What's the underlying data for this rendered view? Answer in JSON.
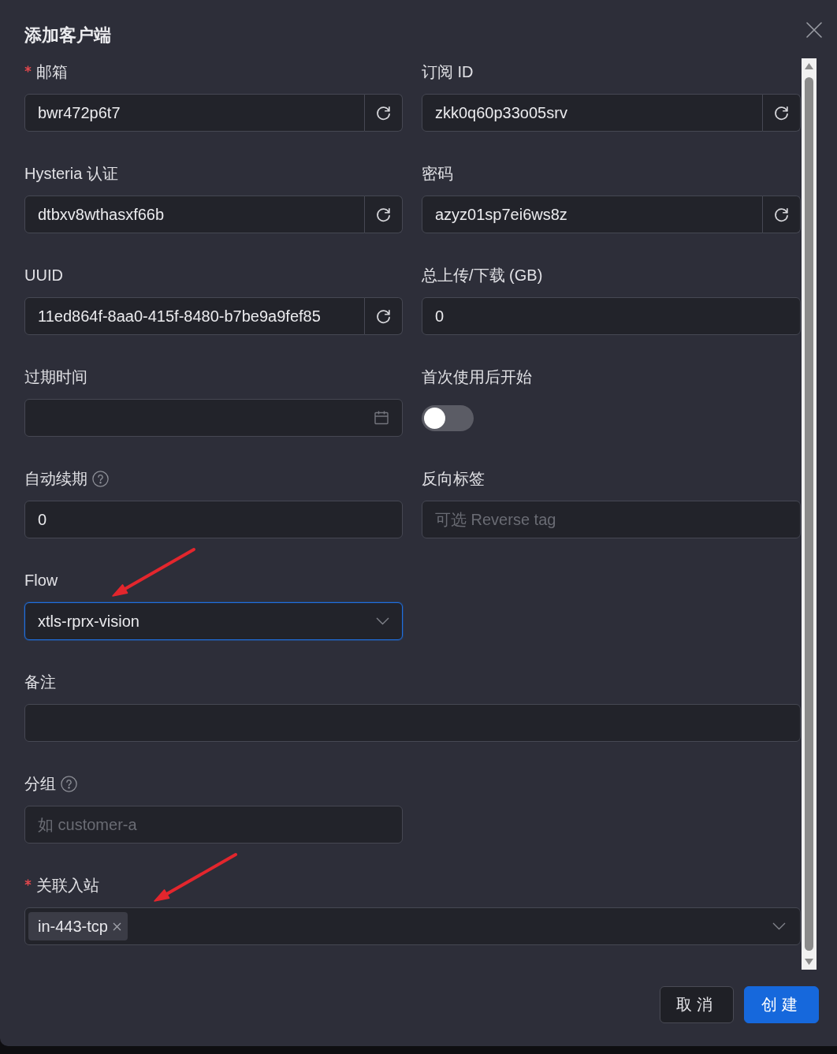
{
  "dialog": {
    "title": "添加客户端",
    "fields": [
      {
        "label": "邮箱",
        "required": true,
        "help": false,
        "wide": false,
        "annotated": false,
        "focused": false,
        "kind": "input",
        "value": "bwr472p6t7",
        "refresh": true
      },
      {
        "label": "订阅 ID",
        "required": false,
        "help": false,
        "wide": false,
        "annotated": false,
        "focused": false,
        "kind": "input",
        "value": "zkk0q60p33o05srv",
        "refresh": true
      },
      {
        "label": "Hysteria 认证",
        "required": false,
        "help": false,
        "wide": false,
        "annotated": false,
        "focused": false,
        "kind": "input",
        "value": "dtbxv8wthasxf66b",
        "refresh": true
      },
      {
        "label": "密码",
        "required": false,
        "help": false,
        "wide": false,
        "annotated": false,
        "focused": false,
        "kind": "input",
        "value": "azyz01sp7ei6ws8z",
        "refresh": true
      },
      {
        "label": "UUID",
        "required": false,
        "help": false,
        "wide": false,
        "annotated": false,
        "focused": false,
        "kind": "input",
        "value": "11ed864f-8aa0-415f-8480-b7be9a9fef85",
        "refresh": true
      },
      {
        "label": "总上传/下载 (GB)",
        "required": false,
        "help": false,
        "wide": false,
        "annotated": false,
        "focused": false,
        "kind": "input",
        "value": "0",
        "refresh": false
      },
      {
        "label": "过期时间",
        "required": false,
        "help": false,
        "wide": false,
        "annotated": false,
        "focused": false,
        "kind": "date"
      },
      {
        "label": "首次使用后开始",
        "required": false,
        "help": false,
        "annotated": false,
        "focused": false,
        "kind": "switch",
        "on": false
      },
      {
        "label": "自动续期",
        "required": false,
        "help": true,
        "wide": false,
        "annotated": false,
        "focused": false,
        "kind": "input",
        "value": "0",
        "refresh": false
      },
      {
        "label": "反向标签",
        "required": false,
        "help": false,
        "wide": false,
        "annotated": false,
        "focused": false,
        "kind": "input",
        "placeholder": "可选 Reverse tag",
        "refresh": false
      },
      {
        "label": "Flow",
        "required": false,
        "help": false,
        "wide": false,
        "annotated": true,
        "focused": true,
        "kind": "select",
        "value": "xtls-rprx-vision"
      },
      {
        "label": "备注",
        "required": false,
        "help": false,
        "wide": true,
        "annotated": false,
        "focused": false,
        "kind": "input",
        "refresh": false
      },
      {
        "label": "分组",
        "required": false,
        "help": true,
        "wide": false,
        "annotated": false,
        "focused": false,
        "kind": "input",
        "placeholder": "如 customer-a",
        "refresh": false
      },
      {
        "label": "关联入站",
        "required": true,
        "help": false,
        "wide": true,
        "annotated": true,
        "focused": false,
        "kind": "tags",
        "tags": [
          {
            "label": "in-443-tcp"
          }
        ]
      }
    ],
    "buttons": [
      {
        "label": "取消",
        "kind": "default"
      },
      {
        "label": "创建",
        "kind": "primary"
      }
    ]
  }
}
